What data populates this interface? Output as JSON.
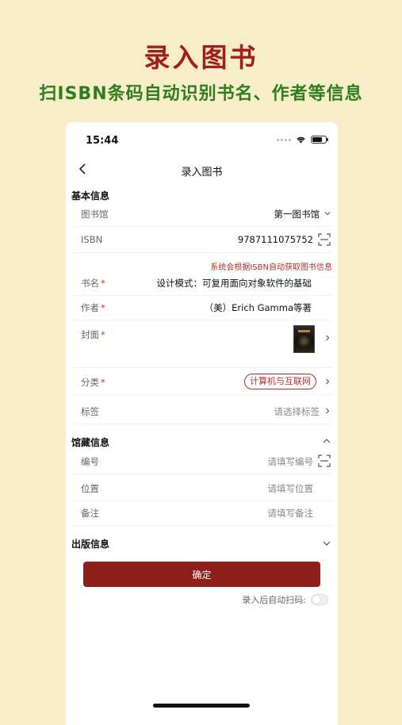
{
  "promo": {
    "title": "录入图书",
    "subtitle": "扫ISBN条码自动识别书名、作者等信息"
  },
  "status_bar": {
    "time": "15:44"
  },
  "nav": {
    "title": "录入图书",
    "back_icon": "chevron-left-icon"
  },
  "basic_info": {
    "section_title": "基本信息",
    "library": {
      "label": "图书馆",
      "value": "第一图书馆"
    },
    "isbn": {
      "label": "ISBN",
      "value": "9787111075752"
    },
    "hint": "系统会根据ISBN自动获取图书信息",
    "book_name": {
      "label": "书名",
      "required_mark": "*",
      "value": "设计模式：可复用面向对象软件的基础"
    },
    "author": {
      "label": "作者",
      "required_mark": "*",
      "value": "（美）Erich Gamma等著"
    },
    "cover": {
      "label": "封面",
      "required_mark": "*"
    },
    "category": {
      "label": "分类",
      "required_mark": "*",
      "value": "计算机与互联网"
    },
    "tags": {
      "label": "标签",
      "placeholder": "请选择标签"
    }
  },
  "collection_info": {
    "section_title": "馆藏信息",
    "number": {
      "label": "编号",
      "placeholder": "请填写编号"
    },
    "location": {
      "label": "位置",
      "placeholder": "请填写位置"
    },
    "remark": {
      "label": "备注",
      "placeholder": "请填写备注"
    }
  },
  "publish_info": {
    "section_title": "出版信息"
  },
  "actions": {
    "confirm_label": "确定",
    "auto_scan_label": "录入后自动扫码:",
    "auto_scan_enabled": false
  },
  "colors": {
    "background": "#f8edc9",
    "promo_title": "#a31d1a",
    "promo_subtitle": "#2e7d1f",
    "accent": "#8e1f1a"
  }
}
